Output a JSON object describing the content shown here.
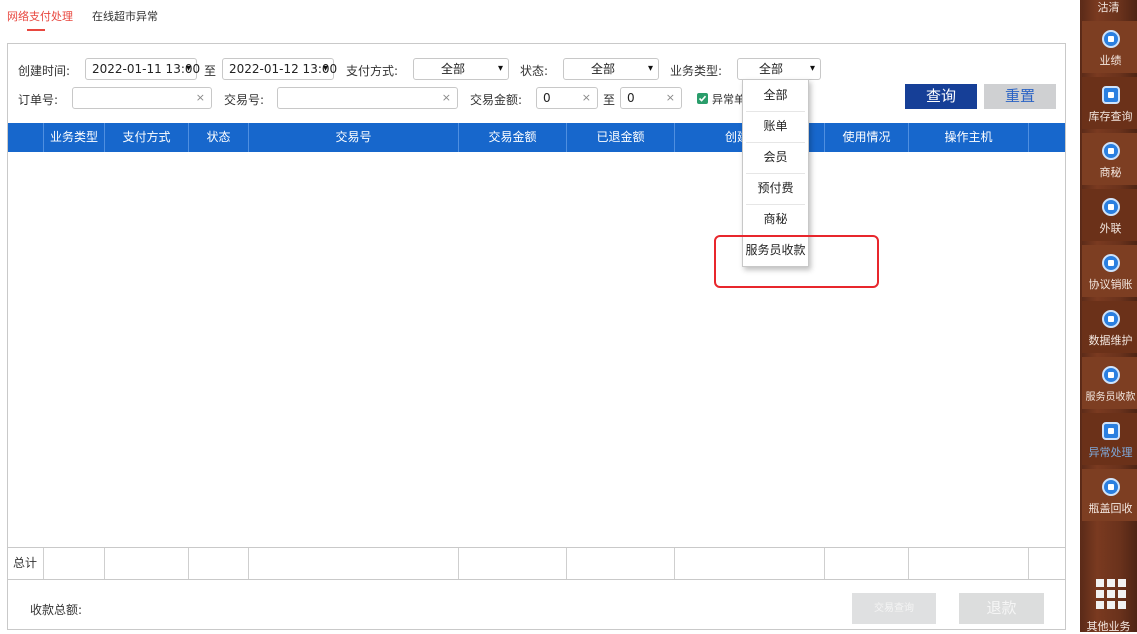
{
  "tabs": [
    {
      "label": "网络支付处理",
      "active": true
    },
    {
      "label": "在线超市异常",
      "active": false
    }
  ],
  "filters": {
    "create_time_label": "创建时间:",
    "start_time": "2022-01-11 13:00",
    "to_label": "至",
    "end_time": "2022-01-12 13:00",
    "pay_method_label": "支付方式:",
    "pay_method_value": "全部",
    "status_label": "状态:",
    "status_value": "全部",
    "biz_type_label": "业务类型:",
    "biz_type_value": "全部",
    "order_no_label": "订单号:",
    "trade_no_label": "交易号:",
    "trade_amount_label": "交易金额:",
    "amount_min": "0",
    "amount_to_label": "至",
    "amount_max": "0",
    "abnormal_label": "异常单",
    "clear_glyph": "×",
    "caret_glyph": "▾"
  },
  "buttons": {
    "query": "查询",
    "reset": "重置",
    "trade_query": "交易查询",
    "refund": "退款"
  },
  "table": {
    "columns": [
      "业务类型",
      "支付方式",
      "状态",
      "交易号",
      "交易金额",
      "已退金额",
      "创建",
      "使用情况",
      "操作主机"
    ],
    "footer_total_label": "总计"
  },
  "summary": {
    "total_received_label": "收款总额:"
  },
  "dropdown": {
    "options": [
      "全部",
      "账单",
      "会员",
      "预付费",
      "商秘",
      "服务员收款"
    ]
  },
  "sidebar": {
    "top_partial": "沽清",
    "items": [
      {
        "label": "业绩",
        "icon": "pie-chart-icon"
      },
      {
        "label": "库存查询",
        "icon": "grid-icon"
      },
      {
        "label": "商秘",
        "icon": "download-icon"
      },
      {
        "label": "外联",
        "icon": "link-icon"
      },
      {
        "label": "协议销账",
        "icon": "download-icon"
      },
      {
        "label": "数据维护",
        "icon": "pie-chart-icon"
      },
      {
        "label": "服务员收款",
        "icon": "user-icon"
      },
      {
        "label": "异常处理",
        "icon": "table-icon"
      },
      {
        "label": "瓶盖回收",
        "icon": "bag-icon"
      }
    ],
    "bottom_label": "其他业务"
  },
  "colors": {
    "accent_red": "#e8473f",
    "table_header": "#1767cc",
    "query_button": "#163f97",
    "annotation": "#e8262c",
    "sidebar_wood": "#7a3a20"
  }
}
